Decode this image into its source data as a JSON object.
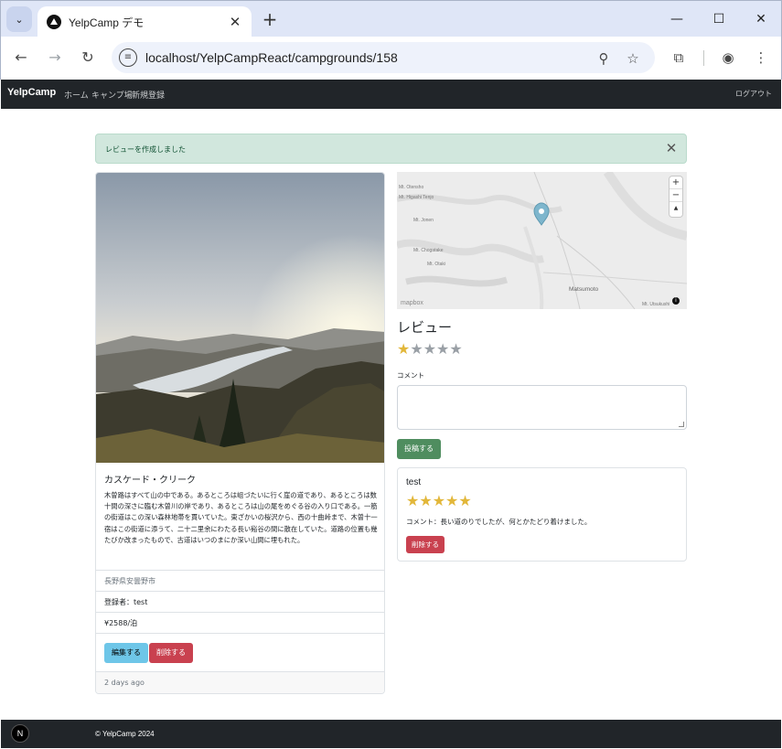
{
  "browser": {
    "tab_title": "YelpCamp デモ",
    "url": "localhost/YelpCampReact/campgrounds/158",
    "icons": [
      "tab-search-icon",
      "close-icon",
      "plus-icon",
      "minimize-icon",
      "maximize-icon",
      "close-window-icon",
      "back-arrow-icon",
      "forward-arrow-icon",
      "reload-icon",
      "site-info-icon",
      "zoom-out-icon",
      "star-icon",
      "extensions-icon",
      "profile-icon",
      "more-icon"
    ]
  },
  "navbar": {
    "brand": "YelpCamp",
    "links": [
      "ホーム",
      "キャンプ場",
      "新規登録"
    ],
    "logout": "ログアウト"
  },
  "alert": {
    "message": "レビューを作成しました"
  },
  "campground": {
    "title": "カスケード・クリーク",
    "description": "木曽路はすべて山の中である。あるところは岨づたいに行く崖の道であり、あるところは数十間の深さに臨む木曽川の岸であり、あるところは山の尾をめぐる谷の入り口である。一筋の街道はこの深い森林地帯を貫いていた。東ざかいの桜沢から、西の十曲峠まで、木曽十一宿はこの街道に添うて、二十二里余にわたる長い谿谷の間に散在していた。道路の位置も幾たびか改まったもので、古道はいつのまにか深い山間に埋もれた。",
    "location": "長野県安曇野市",
    "author": "登録者：test",
    "price": "¥2588/泊",
    "edit_label": "編集する",
    "delete_label": "削除する",
    "posted": "2 days ago"
  },
  "map": {
    "labels": [
      "Mt. Otenshо",
      "Mt. Higashi Tenjo",
      "Mt. Jonen",
      "Mt. Chogatake",
      "Mt. Otaki",
      "Matsumoto",
      "Mt. Utsukushi"
    ],
    "zoom_in": "+",
    "zoom_out": "−",
    "compass": "▲",
    "attribution": "mapbox"
  },
  "review_form": {
    "heading": "レビュー",
    "rating": 1,
    "max_rating": 5,
    "comment_label": "コメント",
    "comment_value": "",
    "submit_label": "投稿する"
  },
  "reviews": [
    {
      "user": "test",
      "rating": 5,
      "comment": "コメント：長い道のりでしたが、何とかたどり着けました。",
      "delete_label": "削除する"
    }
  ],
  "footer": {
    "text": "© YelpCamp 2024",
    "badge": "N"
  },
  "colors": {
    "navbar": "#212529",
    "success": "#d1e7dd",
    "star_on": "#e2b73a",
    "danger": "#c9414f",
    "info": "#6ec6e8"
  }
}
